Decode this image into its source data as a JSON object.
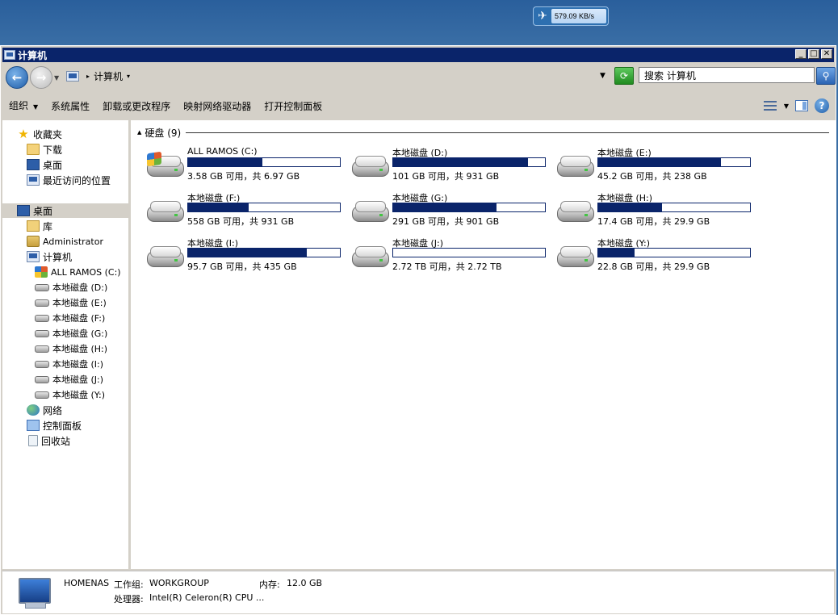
{
  "widget": {
    "speed": "579.09 KB/s"
  },
  "window": {
    "title": "计算机"
  },
  "titlebar_buttons": {
    "minimize": "_",
    "maximize": "□",
    "close": "✕"
  },
  "address": {
    "crumb": "计算机",
    "search_placeholder": "搜索 计算机"
  },
  "toolbar": {
    "organize": "组织",
    "system_properties": "系统属性",
    "uninstall": "卸载或更改程序",
    "map_drive": "映射网络驱动器",
    "control_panel": "打开控制面板"
  },
  "nav": {
    "favorites": "收藏夹",
    "downloads": "下载",
    "desktop_fav": "桌面",
    "recent": "最近访问的位置",
    "desktop": "桌面",
    "libraries": "库",
    "admin": "Administrator",
    "computer": "计算机",
    "drives": [
      "ALL RAMOS  (C:)",
      "本地磁盘 (D:)",
      "本地磁盘 (E:)",
      "本地磁盘 (F:)",
      "本地磁盘 (G:)",
      "本地磁盘 (H:)",
      "本地磁盘 (I:)",
      "本地磁盘 (J:)",
      "本地磁盘 (Y:)"
    ],
    "network": "网络",
    "control_panel": "控制面板",
    "recycle_bin": "回收站"
  },
  "group": {
    "label": "硬盘 (9)"
  },
  "drives": [
    {
      "name": "ALL RAMOS  (C:)",
      "space": "3.58 GB 可用，共 6.97 GB",
      "used_fraction": 0.49,
      "icon": "windows-drive-icon"
    },
    {
      "name": "本地磁盘 (D:)",
      "space": "101 GB 可用，共 931 GB",
      "used_fraction": 0.89,
      "icon": "hard-drive-icon"
    },
    {
      "name": "本地磁盘 (E:)",
      "space": "45.2 GB 可用，共 238 GB",
      "used_fraction": 0.81,
      "icon": "hard-drive-icon"
    },
    {
      "name": "本地磁盘 (F:)",
      "space": "558 GB 可用，共 931 GB",
      "used_fraction": 0.4,
      "icon": "hard-drive-icon"
    },
    {
      "name": "本地磁盘 (G:)",
      "space": "291 GB 可用，共 901 GB",
      "used_fraction": 0.68,
      "icon": "hard-drive-icon"
    },
    {
      "name": "本地磁盘 (H:)",
      "space": "17.4 GB 可用，共 29.9 GB",
      "used_fraction": 0.42,
      "icon": "hard-drive-icon"
    },
    {
      "name": "本地磁盘 (I:)",
      "space": "95.7 GB 可用，共 435 GB",
      "used_fraction": 0.78,
      "icon": "hard-drive-icon"
    },
    {
      "name": "本地磁盘 (J:)",
      "space": "2.72 TB 可用，共 2.72 TB",
      "used_fraction": 0.0,
      "icon": "hard-drive-icon"
    },
    {
      "name": "本地磁盘 (Y:)",
      "space": "22.8 GB 可用，共 29.9 GB",
      "used_fraction": 0.24,
      "icon": "hard-drive-icon"
    }
  ],
  "details": {
    "computer_name": "HOMENAS",
    "workgroup_label": "工作组:",
    "workgroup": "WORKGROUP",
    "memory_label": "内存:",
    "memory": "12.0 GB",
    "cpu_label": "处理器:",
    "cpu": "Intel(R) Celeron(R) CPU ..."
  },
  "colors": {
    "accent": "#0a246a",
    "chrome": "#d4d0c8",
    "desktop": "#3a6ea5"
  }
}
